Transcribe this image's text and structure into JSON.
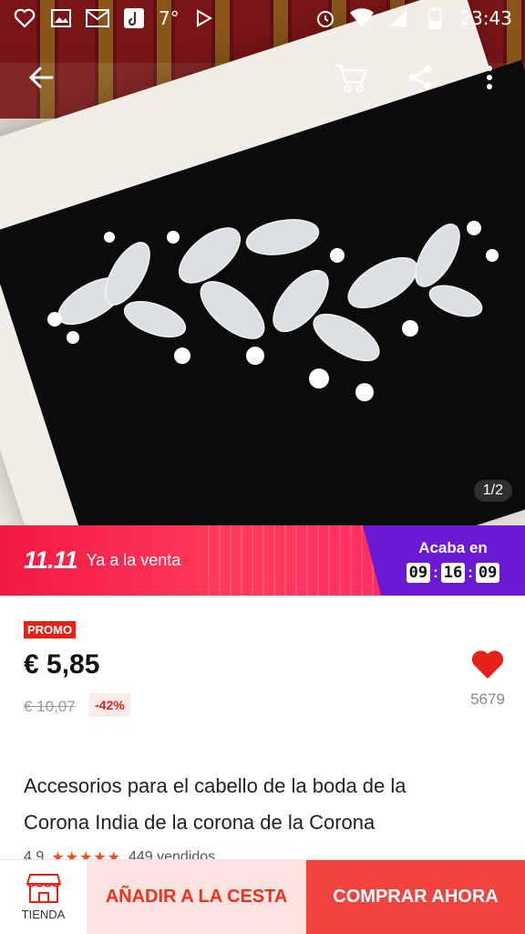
{
  "status_bar": {
    "temperature": "7°",
    "time": "23:43",
    "left_icons": [
      "heart-outline-icon",
      "image-icon",
      "gmail-icon",
      "tiktok-icon"
    ],
    "right_icons": [
      "alarm-icon",
      "wifi-icon",
      "signal-icon",
      "battery-icon"
    ]
  },
  "image_counter": "1/2",
  "banner": {
    "event": "11.11",
    "label": "Ya a la venta",
    "ends_label": "Acaba en",
    "timer": {
      "hours": "09",
      "minutes": "16",
      "seconds": "09"
    },
    "colors": {
      "left": "#f31843",
      "right": "#6b19d3"
    }
  },
  "product": {
    "promo_badge": "PROMO",
    "price": "€ 5,85",
    "old_price": "€ 10,07",
    "discount": "-42%",
    "wishlist_count": "5679",
    "title_line1": "Accesorios para el cabello de la boda de la",
    "title_line2": "Corona India de la corona de la Corona",
    "rating": "4.9",
    "sold": "449 vendidos"
  },
  "bottom_bar": {
    "store_label": "TIENDA",
    "add_to_cart": "AÑADIR A LA CESTA",
    "buy_now": "COMPRAR AHORA"
  },
  "accent_colors": {
    "red": "#e62117",
    "buy": "#f2443f",
    "cart_bg": "#fde3e0"
  }
}
